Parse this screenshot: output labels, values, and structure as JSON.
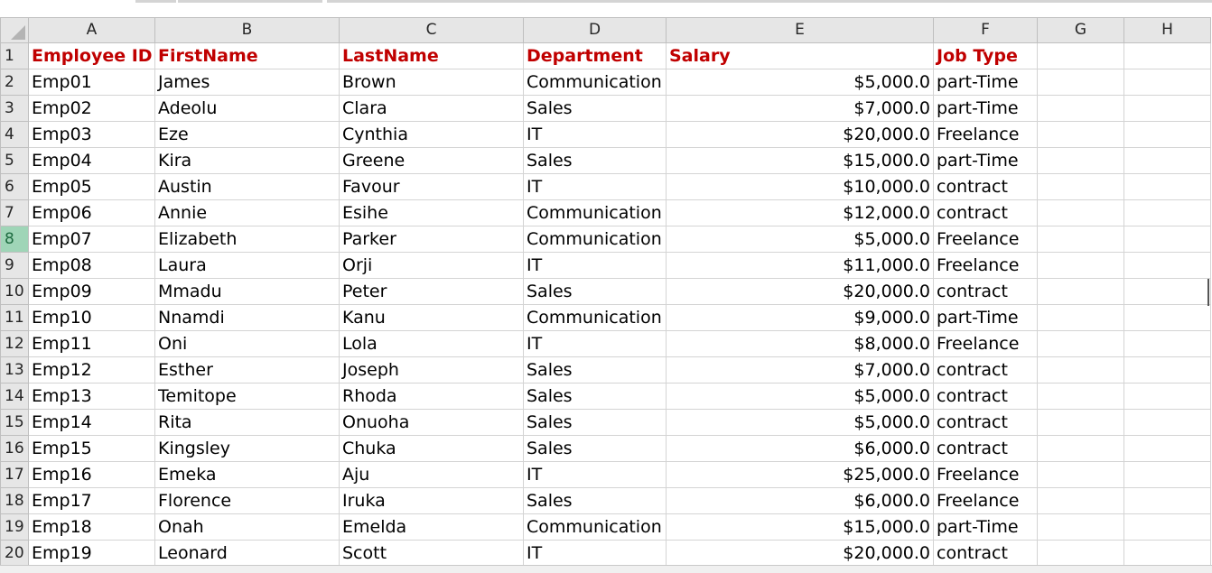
{
  "columns": [
    "A",
    "B",
    "C",
    "D",
    "E",
    "F",
    "G",
    "H"
  ],
  "header_row": {
    "row": "1",
    "cells": [
      "Employee ID",
      "FirstName",
      "LastName",
      "Department",
      "Salary",
      "Job Type",
      "",
      ""
    ]
  },
  "rows": [
    {
      "row": "2",
      "cells": [
        "Emp01",
        "James",
        "Brown",
        "Communication",
        "$5,000.0",
        "part-Time",
        "",
        ""
      ]
    },
    {
      "row": "3",
      "cells": [
        "Emp02",
        "Adeolu",
        "Clara",
        "Sales",
        "$7,000.0",
        "part-Time",
        "",
        ""
      ]
    },
    {
      "row": "4",
      "cells": [
        "Emp03",
        "Eze",
        "Cynthia",
        "IT",
        "$20,000.0",
        "Freelance",
        "",
        ""
      ]
    },
    {
      "row": "5",
      "cells": [
        "Emp04",
        "Kira",
        "Greene",
        "Sales",
        "$15,000.0",
        "part-Time",
        "",
        ""
      ]
    },
    {
      "row": "6",
      "cells": [
        "Emp05",
        "Austin",
        "Favour",
        "IT",
        "$10,000.0",
        "contract",
        "",
        ""
      ]
    },
    {
      "row": "7",
      "cells": [
        "Emp06",
        "Annie",
        "Esihe",
        "Communication",
        "$12,000.0",
        "contract",
        "",
        ""
      ]
    },
    {
      "row": "8",
      "cells": [
        "Emp07",
        "Elizabeth",
        "Parker",
        "Communication",
        "$5,000.0",
        "Freelance",
        "",
        ""
      ]
    },
    {
      "row": "9",
      "cells": [
        "Emp08",
        "Laura",
        "Orji",
        "IT",
        "$11,000.0",
        "Freelance",
        "",
        ""
      ]
    },
    {
      "row": "10",
      "cells": [
        "Emp09",
        "Mmadu",
        "Peter",
        "Sales",
        "$20,000.0",
        "contract",
        "",
        ""
      ]
    },
    {
      "row": "11",
      "cells": [
        "Emp10",
        "Nnamdi",
        "Kanu",
        "Communication",
        "$9,000.0",
        "part-Time",
        "",
        ""
      ]
    },
    {
      "row": "12",
      "cells": [
        "Emp11",
        "Oni",
        "Lola",
        "IT",
        "$8,000.0",
        "Freelance",
        "",
        ""
      ]
    },
    {
      "row": "13",
      "cells": [
        "Emp12",
        "Esther",
        "Joseph",
        "Sales",
        "$7,000.0",
        "contract",
        "",
        ""
      ]
    },
    {
      "row": "14",
      "cells": [
        "Emp13",
        "Temitope",
        "Rhoda",
        "Sales",
        "$5,000.0",
        "contract",
        "",
        ""
      ]
    },
    {
      "row": "15",
      "cells": [
        "Emp14",
        "Rita",
        "Onuoha",
        "Sales",
        "$5,000.0",
        "contract",
        "",
        ""
      ]
    },
    {
      "row": "16",
      "cells": [
        "Emp15",
        "Kingsley",
        "Chuka",
        "Sales",
        "$6,000.0",
        "contract",
        "",
        ""
      ]
    },
    {
      "row": "17",
      "cells": [
        "Emp16",
        "Emeka",
        "Aju",
        "IT",
        "$25,000.0",
        "Freelance",
        "",
        ""
      ]
    },
    {
      "row": "18",
      "cells": [
        "Emp17",
        "Florence",
        "Iruka",
        "Sales",
        "$6,000.0",
        "Freelance",
        "",
        ""
      ]
    },
    {
      "row": "19",
      "cells": [
        "Emp18",
        "Onah",
        "Emelda",
        "Communication",
        "$15,000.0",
        "part-Time",
        "",
        ""
      ]
    },
    {
      "row": "20",
      "cells": [
        "Emp19",
        "Leonard",
        "Scott",
        "IT",
        "$20,000.0",
        "contract",
        "",
        ""
      ]
    }
  ],
  "selected_row": "8",
  "colors": {
    "header_text": "#c00000",
    "selected_row_header": "#9fd5b7",
    "gridline": "#d4d4d4"
  }
}
